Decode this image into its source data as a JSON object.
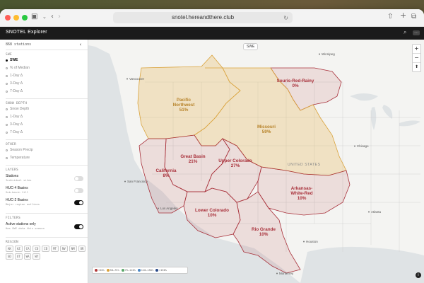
{
  "browser": {
    "url": "snotel.hereandthere.club"
  },
  "app": {
    "title": "SNOTEL Explorer"
  },
  "sidebar": {
    "count_label": "868 stations",
    "sections": {
      "swe": "SWE",
      "snow_depth": "SNOW DEPTH",
      "other": "OTHER",
      "layers": "LAYERS",
      "filters": "FILTERS",
      "region": "REGION"
    },
    "swe_options": [
      "SWE",
      "% of Median",
      "1-Day Δ",
      "3-Day Δ",
      "7-Day Δ"
    ],
    "snow_depth_options": [
      "Snow Depth",
      "1-Day Δ",
      "3-Day Δ",
      "7-Day Δ"
    ],
    "other_options": [
      "Season Precip",
      "Temperature"
    ],
    "layers": [
      {
        "title": "Stations",
        "desc": "Individual sites",
        "on": false
      },
      {
        "title": "HUC-4 Basins",
        "desc": "Sub-basin fill",
        "on": false
      },
      {
        "title": "HUC-2 Basins",
        "desc": "Major region outlines",
        "on": true
      }
    ],
    "filter": {
      "title": "Active stations only",
      "desc": "Has SWE data this season",
      "on": true
    },
    "regions": [
      "AK",
      "AZ",
      "CA",
      "CO",
      "ID",
      "MT",
      "NV",
      "NM",
      "OR",
      "SD",
      "UT",
      "WA",
      "WY"
    ]
  },
  "map": {
    "swe_button": "SWE",
    "country_label": "UNITED STATES",
    "basins": [
      {
        "name1": "Souris-Red-Rainy",
        "name2": "",
        "value": "0%"
      },
      {
        "name1": "Pacific",
        "name2": "Northwest",
        "value": "51%"
      },
      {
        "name1": "Missouri",
        "name2": "",
        "value": "59%"
      },
      {
        "name1": "Great Basin",
        "name2": "",
        "value": "21%"
      },
      {
        "name1": "Upper Colorado",
        "name2": "",
        "value": "27%"
      },
      {
        "name1": "California",
        "name2": "",
        "value": "8%"
      },
      {
        "name1": "Arkansas-",
        "name2": "White-Red",
        "value": "10%"
      },
      {
        "name1": "Lower Colorado",
        "name2": "",
        "value": "10%"
      },
      {
        "name1": "Rio Grande",
        "name2": "",
        "value": "10%"
      }
    ],
    "cities": [
      "Vancouver",
      "Winnipeg",
      "Chicago",
      "San Francisco",
      "Los Angeles",
      "Atlanta",
      "Houston",
      "Monterrey"
    ],
    "legend": [
      {
        "label": "<50%",
        "color": "#b23a3a"
      },
      {
        "label": "50–75%",
        "color": "#d9a23a"
      },
      {
        "label": "75–110%",
        "color": "#5aa86a"
      },
      {
        "label": "110–150%",
        "color": "#4a86c4"
      },
      {
        "label": ">150%",
        "color": "#2a4a8a"
      }
    ]
  }
}
